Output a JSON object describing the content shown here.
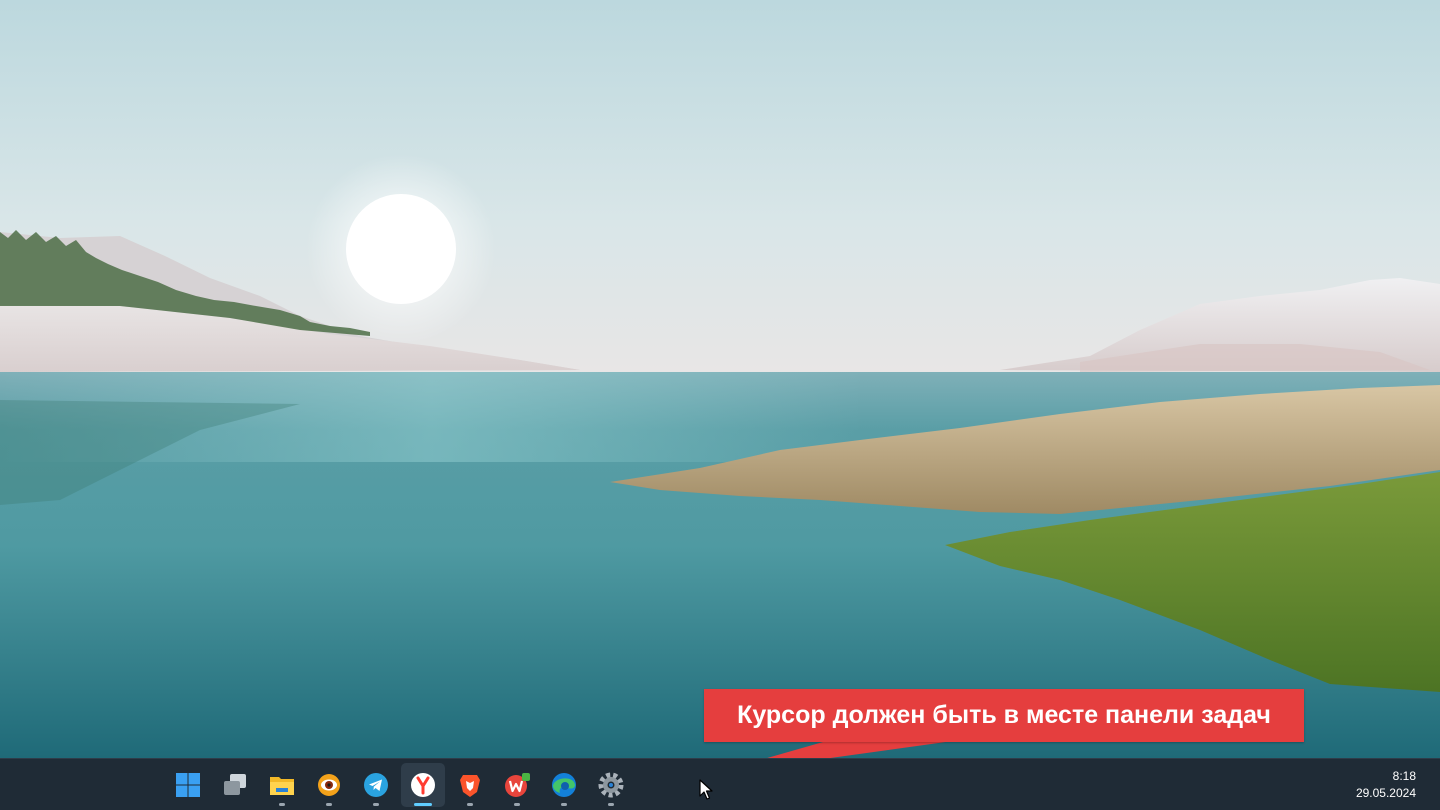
{
  "annotation": {
    "text": "Курсор должен быть в месте панели задач"
  },
  "taskbar": {
    "apps": [
      {
        "name": "start",
        "icon": "windows-start-icon",
        "running": false
      },
      {
        "name": "task-view",
        "icon": "task-view-icon",
        "running": false
      },
      {
        "name": "file-explorer",
        "icon": "folder-icon",
        "running": true
      },
      {
        "name": "xnview",
        "icon": "eye-viewer-icon",
        "running": true
      },
      {
        "name": "telegram",
        "icon": "telegram-icon",
        "running": true
      },
      {
        "name": "yandex-browser",
        "icon": "yandex-browser-icon",
        "running": true,
        "active": true
      },
      {
        "name": "brave",
        "icon": "brave-lion-icon",
        "running": true
      },
      {
        "name": "wps-office",
        "icon": "wps-office-icon",
        "running": true
      },
      {
        "name": "edge",
        "icon": "edge-icon",
        "running": true
      },
      {
        "name": "settings",
        "icon": "gear-icon",
        "running": true
      }
    ],
    "clock": {
      "time": "8:18",
      "date": "29.05.2024"
    }
  },
  "colors": {
    "taskbar": "#1f2b36",
    "callout": "#e53e3e",
    "active_indicator": "#60cdff"
  }
}
